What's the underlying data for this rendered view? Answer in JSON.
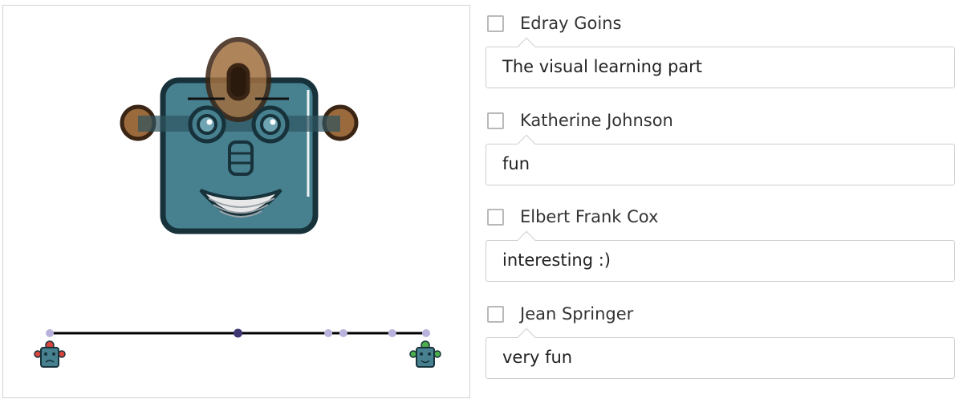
{
  "responses": [
    {
      "name": "Edray Goins",
      "text": "The visual learning part"
    },
    {
      "name": "Katherine Johnson",
      "text": "fun"
    },
    {
      "name": "Elbert Frank Cox",
      "text": "interesting :)"
    },
    {
      "name": "Jean Springer",
      "text": "very fun"
    }
  ],
  "graph": {
    "slider_points": [
      0.0,
      0.5,
      0.74,
      0.78,
      0.91,
      1.0
    ],
    "selected_value": 0.5,
    "left_robot_accent": "#d9453c",
    "right_robot_accent": "#4cae4c"
  },
  "colors": {
    "robot_face": "#47808f",
    "robot_outline": "#17323a",
    "robot_ears": "#8a5a33",
    "slider_point_light": "#b9b2dc",
    "slider_point_dark": "#3f3674"
  }
}
